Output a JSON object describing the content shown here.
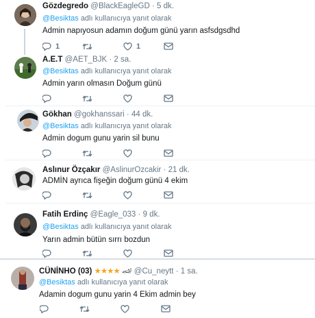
{
  "reply_prefix": "adlı kullanıcıya yanıt olarak",
  "colors": {
    "accent": "#1da1f2",
    "muted": "#657786",
    "star": "#f5a623"
  },
  "tweets": [
    {
      "name": "Gözdegredo",
      "handle": "@BlackEagleGD",
      "dot": "·",
      "time": "5 dk.",
      "reply_to": "@Besiktas",
      "text": "Admin napıyosun adamın doğum günü yarın asfsdgsdhd",
      "reply_count": "1",
      "retweet_count": "",
      "like_count": "1"
    },
    {
      "name": "A.E.T",
      "handle": "@AET_BJK",
      "dot": "·",
      "time": "2 sa.",
      "reply_to": "@Besiktas",
      "text": "Admin yarın olmasın Doğum günü",
      "reply_count": "",
      "retweet_count": "",
      "like_count": ""
    },
    {
      "name": "Gökhan",
      "handle": "@gokhanssari",
      "dot": "·",
      "time": "44 dk.",
      "reply_to": "@Besiktas",
      "text": "Admin dogum gunu yarin sil bunu",
      "reply_count": "",
      "retweet_count": "",
      "like_count": ""
    },
    {
      "name": "Aslınur Özçakır",
      "handle": "@AslinurOzcakir",
      "dot": "·",
      "time": "21 dk.",
      "reply_to": "",
      "text": "ADMİN ayrıca fişeğin doğum günü 4 ekim",
      "reply_count": "",
      "retweet_count": "",
      "like_count": ""
    },
    {
      "name": "Fatih Erdinç",
      "handle": "@Eagle_033",
      "dot": "·",
      "time": "9 dk.",
      "reply_to": "@Besiktas",
      "text": "Yarın admin bütün sırrı bozdun",
      "reply_count": "",
      "retweet_count": "",
      "like_count": ""
    },
    {
      "name": "CÜNİNHO (03)",
      "name_stars": "★★★★",
      "name_car": "🏎",
      "handle": "@Cu_neytt",
      "dot": "·",
      "time": "1 sa.",
      "reply_to": "@Besiktas",
      "text": "Adamin dogum gunu yarin 4 Ekim admin bey",
      "reply_count": "",
      "retweet_count": "",
      "like_count": ""
    }
  ]
}
